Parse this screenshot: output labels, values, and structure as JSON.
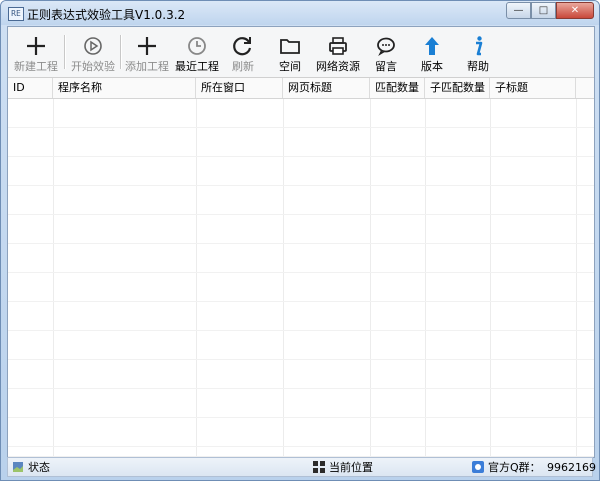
{
  "window": {
    "title": "正则表达式效验工具V1.0.3.2",
    "icon_text": "RE",
    "controls": {
      "minimize": "—",
      "maximize": "□",
      "close": "✕"
    }
  },
  "toolbar": {
    "buttons": [
      {
        "label": "新建工程",
        "icon": "plus-icon",
        "glyph": "+",
        "enabled": false
      },
      {
        "label": "开始效验",
        "icon": "play-icon",
        "glyph": "▶",
        "enabled": false
      },
      {
        "label": "添加工程",
        "icon": "plus-icon",
        "glyph": "+",
        "enabled": false
      },
      {
        "label": "最近工程",
        "icon": "clock-icon",
        "glyph": "◷",
        "enabled": true
      },
      {
        "label": "刷新",
        "icon": "refresh-icon",
        "glyph": "↻",
        "enabled": false
      },
      {
        "label": "空间",
        "icon": "folder-icon",
        "glyph": "▭",
        "enabled": true
      },
      {
        "label": "网络资源",
        "icon": "printer-icon",
        "glyph": "⎙",
        "enabled": true
      },
      {
        "label": "留言",
        "icon": "chat-icon",
        "glyph": "…",
        "enabled": true
      },
      {
        "label": "版本",
        "icon": "arrow-up-icon",
        "glyph": "↑",
        "enabled": true
      },
      {
        "label": "帮助",
        "icon": "info-icon",
        "glyph": "i",
        "enabled": true
      }
    ]
  },
  "table": {
    "columns": [
      "ID",
      "程序名称",
      "所在窗口",
      "网页标题",
      "匹配数量",
      "子匹配数量",
      "子标题"
    ],
    "rows": []
  },
  "statusbar": {
    "status_label": "状态",
    "location_label": "当前位置",
    "qq_label": "官方Q群：",
    "qq_number": "9962169"
  },
  "colors": {
    "accent_blue": "#1a7fd4",
    "disabled_text": "#8c8c8c"
  }
}
